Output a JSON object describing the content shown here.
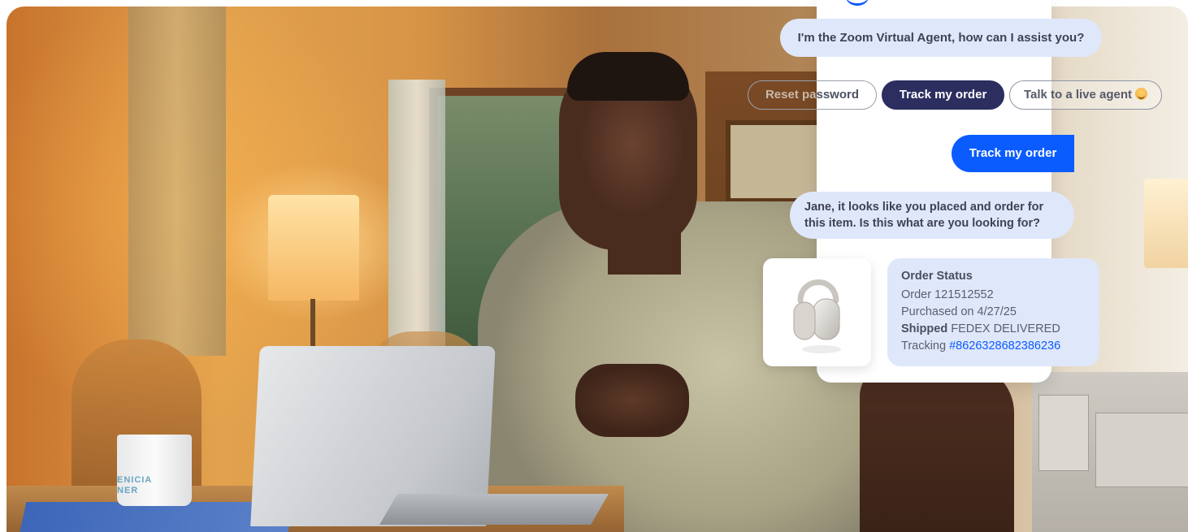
{
  "chat": {
    "greeting": "I'm the Zoom Virtual Agent, how can I assist you?",
    "quick_replies": {
      "reset_part1": "Reset pa",
      "reset_part2": "ssword",
      "track": "Track my order",
      "live_agent": "Talk to a live agent"
    },
    "user_message": "Track my order",
    "agent_reply_line1": "Jane, it looks like you placed and order for",
    "agent_reply_line2": "this item. Is this what are you looking for?"
  },
  "order": {
    "title": "Order Status",
    "order_line": "Order 121512552",
    "purchased": "Purchased on 4/27/25",
    "shipped_label": "Shipped",
    "shipped_value": "FEDEX DELIVERED",
    "tracking_label": "Tracking",
    "tracking_number": "#8626328682386236"
  },
  "photo": {
    "mug_text_line1": "ENICIA",
    "mug_text_line2": "NER"
  },
  "colors": {
    "accent": "#0b5cff",
    "chip_selected": "#2c2e60",
    "bubble_bg": "#dfe7fb"
  },
  "icons": {
    "live_agent_emoji": "smiling-face-icon",
    "product": "headphones-icon"
  }
}
